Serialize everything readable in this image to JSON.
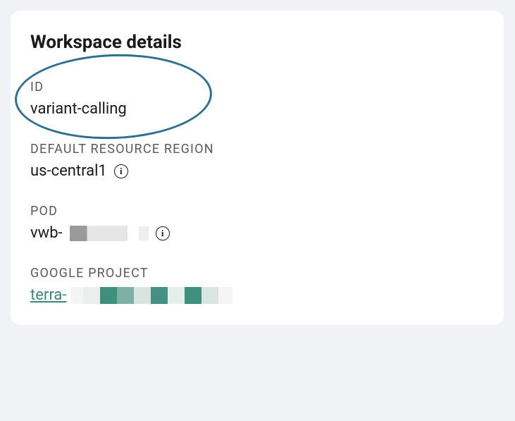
{
  "card": {
    "title": "Workspace details",
    "fields": {
      "id": {
        "label": "ID",
        "value": "variant-calling"
      },
      "region": {
        "label": "DEFAULT RESOURCE REGION",
        "value": "us-central1"
      },
      "pod": {
        "label": "POD",
        "prefix": "vwb-"
      },
      "project": {
        "label": "GOOGLE PROJECT",
        "prefix": "terra-"
      }
    }
  }
}
